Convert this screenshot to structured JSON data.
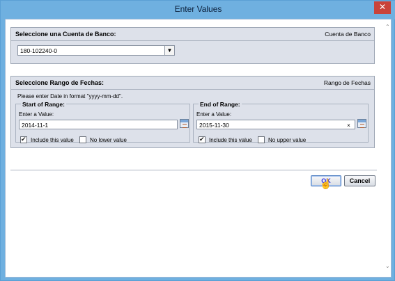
{
  "window": {
    "title": "Enter Values",
    "close_glyph": "✕"
  },
  "bank_panel": {
    "title": "Seleccione una Cuenta de Banco:",
    "right_label": "Cuenta de Banco",
    "selected_value": "180-102240-0"
  },
  "date_panel": {
    "title": "Seleccione Rango de Fechas:",
    "right_label": "Rango de Fechas",
    "hint": "Please enter Date in format \"yyyy-mm-dd\".",
    "start": {
      "legend": "Start of Range:",
      "enter_label": "Enter a Value:",
      "value": "2014-11-1",
      "include_label": "Include this value",
      "include_checked": true,
      "limit_label": "No lower value",
      "limit_checked": false
    },
    "end": {
      "legend": "End of Range:",
      "enter_label": "Enter a Value:",
      "value": "2015-11-30",
      "clear_glyph": "×",
      "include_label": "Include this value",
      "include_checked": true,
      "limit_label": "No upper value",
      "limit_checked": false
    }
  },
  "buttons": {
    "ok": "OK",
    "cancel": "Cancel"
  },
  "scroll": {
    "up_glyph": "⌃",
    "down_glyph": "⌄"
  },
  "icons": {
    "dropdown": "chevron-down-icon",
    "calendar": "calendar-icon",
    "cursor": "hand-pointer-icon"
  }
}
